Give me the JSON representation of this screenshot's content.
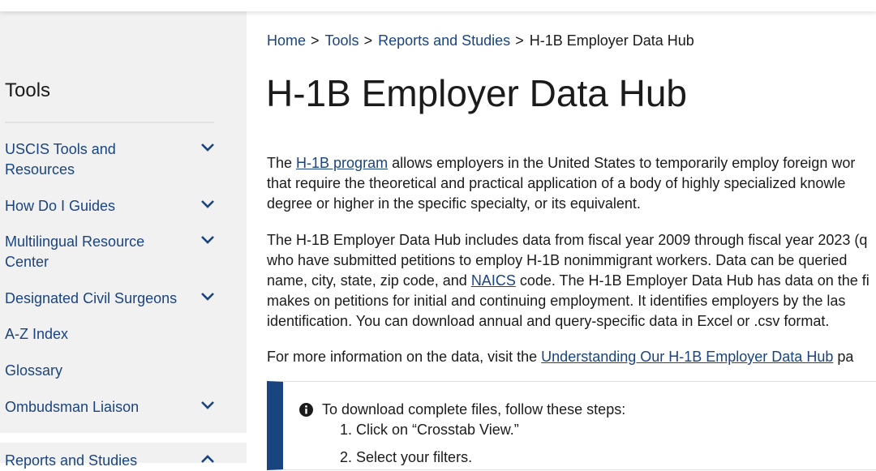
{
  "sidebar": {
    "title": "Tools",
    "items": [
      {
        "label": "USCIS Tools and Resources",
        "expandable": true,
        "expanded": false
      },
      {
        "label": "How Do I Guides",
        "expandable": true,
        "expanded": false
      },
      {
        "label": "Multilingual Resource Center",
        "expandable": true,
        "expanded": false
      },
      {
        "label": "Designated Civil Surgeons",
        "expandable": true,
        "expanded": false
      },
      {
        "label": "A-Z Index",
        "expandable": false
      },
      {
        "label": "Glossary",
        "expandable": false
      },
      {
        "label": "Ombudsman Liaison",
        "expandable": true,
        "expanded": false
      },
      {
        "label": "Reports and Studies",
        "expandable": true,
        "expanded": true
      }
    ]
  },
  "breadcrumb": {
    "items": [
      "Home",
      "Tools",
      "Reports and Studies"
    ],
    "separator": ">",
    "current": "H-1B Employer Data Hub"
  },
  "page_title": "H-1B Employer Data Hub",
  "intro": {
    "p1_before": "The ",
    "p1_link": "H-1B program",
    "p1_after_line1": " allows employers in the United States to temporarily employ foreign wor",
    "p1_line2": "that require the theoretical and practical application of a body of highly specialized knowle",
    "p1_line3": "degree or higher in the specific specialty, or its equivalent.",
    "p2_line1": "The H-1B Employer Data Hub includes data from fiscal year 2009 through fiscal year 2023 (q",
    "p2_line2": "who have submitted petitions to employ H-1B nonimmigrant workers. Data can be queried",
    "p2_line3_before": "name, city, state, zip code, and ",
    "p2_line3_link": "NAICS",
    "p2_line3_after": " code. The H-1B Employer Data Hub has data on the fi",
    "p2_line4": "makes on petitions for initial and continuing employment. It identifies employers by the las",
    "p2_line5": "identification. You can download annual and query-specific data in Excel or .csv format.",
    "p3_before": "For more information on the data, visit the ",
    "p3_link": "Understanding Our H-1B Employer Data Hub",
    "p3_after": " pa"
  },
  "callout": {
    "title": "To download complete files, follow these steps:",
    "steps": [
      "1. Click on “Crosstab View.”",
      "2. Select your filters."
    ],
    "icon": "info-icon"
  },
  "colors": {
    "link": "#1a4480",
    "text": "#1b1b1b",
    "sidebar_bg": "#f1f1f1",
    "callout_border": "#1a4480"
  }
}
